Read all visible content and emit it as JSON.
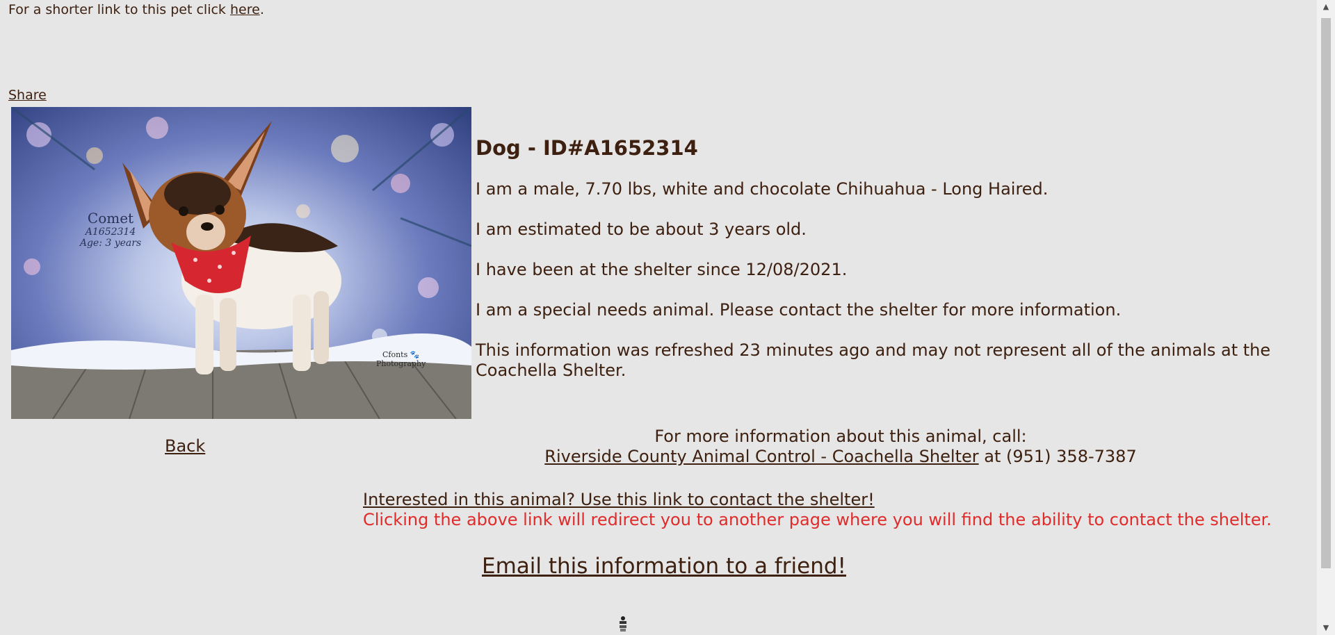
{
  "top_line": {
    "prefix": "For a shorter link to this pet click ",
    "link": "here",
    "suffix": "."
  },
  "share_label": "Share",
  "photo": {
    "overlay_name": "Comet",
    "overlay_id": "A1652314",
    "overlay_age": "Age: 3 years",
    "watermark_line1": "Cfonts 🐾",
    "watermark_line2": "Photography"
  },
  "back_label": "Back",
  "details": {
    "heading": "Dog - ID#A1652314",
    "lines": [
      "I am a male, 7.70 lbs, white and chocolate Chihuahua - Long Haired.",
      "I am estimated to be about 3 years old.",
      "I have been at the shelter since 12/08/2021.",
      "I am a special needs animal. Please contact the shelter for more information.",
      "This information was refreshed 23 minutes ago and may not represent all of the animals at the Coachella Shelter."
    ]
  },
  "contact": {
    "call_text": "For more information about this animal, call:",
    "shelter_link": "Riverside County Animal Control - Coachella Shelter",
    "phone_text": " at (951) 358-7387"
  },
  "interest": {
    "link": "Interested in this animal? Use this link to contact the shelter!",
    "note": "Clicking the above link will redirect you to another page where you will find the ability to contact the shelter."
  },
  "email_link": "Email this information to a friend!",
  "colors": {
    "text": "#3d2010",
    "background": "#e6e6e6",
    "warning": "#e02b2b"
  }
}
